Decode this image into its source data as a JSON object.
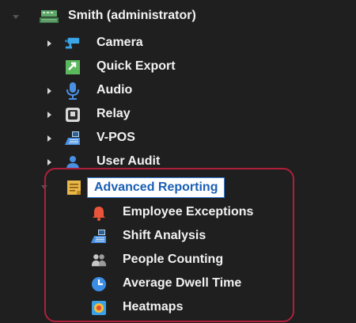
{
  "tree": {
    "root": {
      "label": "Smith (administrator)",
      "icon": "server-icon"
    },
    "items": [
      {
        "label": "Camera",
        "icon": "camera-icon"
      },
      {
        "label": "Quick Export",
        "icon": "export-icon"
      },
      {
        "label": "Audio",
        "icon": "microphone-icon"
      },
      {
        "label": "Relay",
        "icon": "relay-icon"
      },
      {
        "label": "V-POS",
        "icon": "pos-terminal-icon"
      },
      {
        "label": "User Audit",
        "icon": "user-icon"
      }
    ],
    "advanced": {
      "label": "Advanced Reporting",
      "icon": "report-icon",
      "children": [
        {
          "label": "Employee Exceptions",
          "icon": "bell-icon"
        },
        {
          "label": "Shift Analysis",
          "icon": "pos-terminal-icon"
        },
        {
          "label": "People Counting",
          "icon": "people-icon"
        },
        {
          "label": "Average Dwell Time",
          "icon": "clock-icon"
        },
        {
          "label": "Heatmaps",
          "icon": "heatmap-icon"
        }
      ]
    }
  },
  "colors": {
    "background": "#1f1f1f",
    "highlight_border": "#b01f3a",
    "selection_text": "#1a5fb4"
  }
}
